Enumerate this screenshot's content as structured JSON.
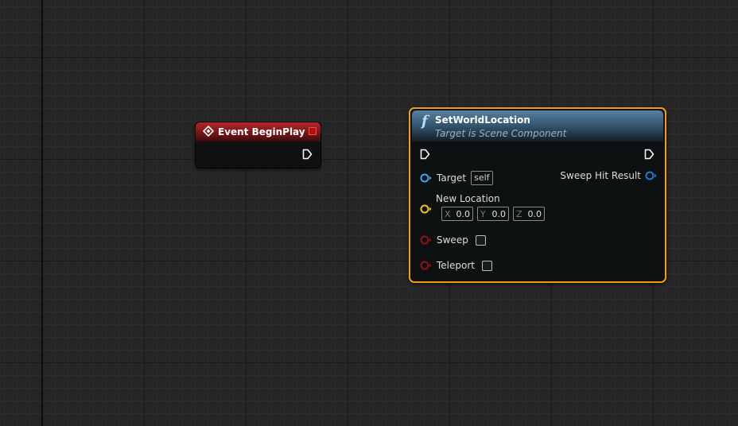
{
  "graph": {
    "background_color": "#262626",
    "event_node": {
      "title": "Event BeginPlay",
      "header_color": "#9a1e20",
      "icon": "event-diamond-icon"
    },
    "function_node": {
      "title": "SetWorldLocation",
      "subtitle": "Target is Scene Component",
      "icon_glyph": "f",
      "header_color": "#3f6a8a",
      "selection_color": "#f29c16",
      "inputs": {
        "target": {
          "label": "Target",
          "default": "self",
          "pin_color": "#3aa6ff"
        },
        "new_location": {
          "label": "New Location",
          "pin_color": "#f5c518",
          "fields": [
            {
              "axis": "X",
              "value": "0.0"
            },
            {
              "axis": "Y",
              "value": "0.0"
            },
            {
              "axis": "Z",
              "value": "0.0"
            }
          ]
        },
        "sweep": {
          "label": "Sweep",
          "pin_color": "#8e1212",
          "checked": false
        },
        "teleport": {
          "label": "Teleport",
          "pin_color": "#8e1212",
          "checked": false
        }
      },
      "outputs": {
        "sweep_hit_result": {
          "label": "Sweep Hit Result",
          "pin_color": "#1f7ad8"
        }
      }
    }
  }
}
